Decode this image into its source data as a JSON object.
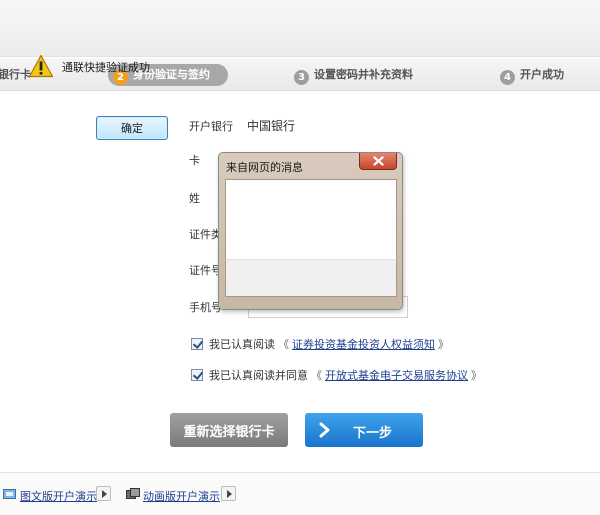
{
  "steps": [
    {
      "num": "",
      "label": "银行卡"
    },
    {
      "num": "2",
      "label": "身份验证与签约"
    },
    {
      "num": "3",
      "label": "设置密码并补充资料"
    },
    {
      "num": "4",
      "label": "开户成功"
    }
  ],
  "form": {
    "bank_label": "开户银行",
    "bank_value": "中国银行",
    "card_label": "卡",
    "name_label": "姓",
    "idtype_label": "证件类",
    "idnum_label": "证件号",
    "phone_label": "手机号"
  },
  "agreements": [
    {
      "prefix": "我已认真阅读",
      "open_quote": "《",
      "link": "证券投资基金投资人权益须知",
      "close_quote": "》"
    },
    {
      "prefix": "我已认真阅读并同意",
      "open_quote": "《",
      "link": "开放式基金电子交易服务协议",
      "close_quote": "》"
    }
  ],
  "buttons": {
    "reselect": "重新选择银行卡",
    "next": "下一步"
  },
  "footer": {
    "graphic_demo": "图文版开户演示",
    "animation_demo": "动画版开户演示"
  },
  "dialog": {
    "title": "来自网页的消息",
    "message": "通联快捷验证成功",
    "ok": "确定"
  },
  "colors": {
    "accent_blue": "#1a74cc",
    "step_active": "#f3a01d",
    "link": "#1f3f8f"
  }
}
